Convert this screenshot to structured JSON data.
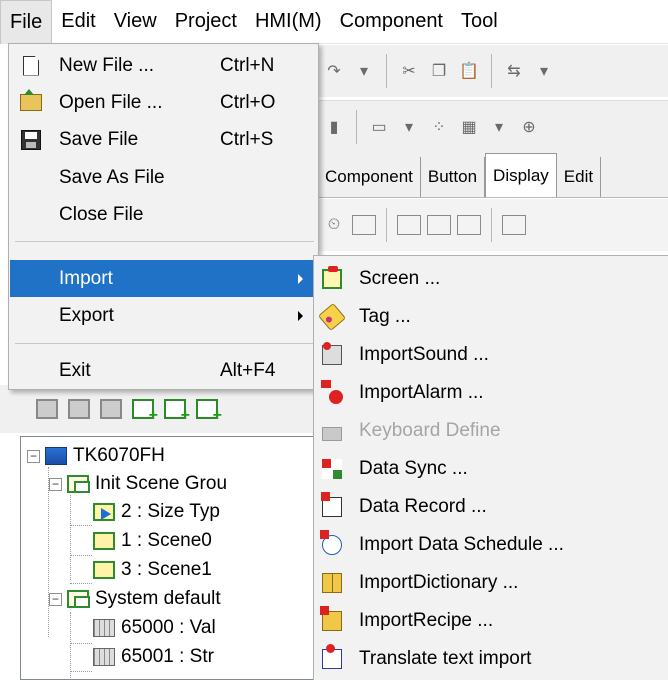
{
  "menubar": {
    "items": [
      {
        "label": "File"
      },
      {
        "label": "Edit"
      },
      {
        "label": "View"
      },
      {
        "label": "Project"
      },
      {
        "label": "HMI(M)"
      },
      {
        "label": "Component"
      },
      {
        "label": "Tool"
      }
    ]
  },
  "file_menu": {
    "items": [
      {
        "label": "New File ...",
        "shortcut": "Ctrl+N",
        "icon": "new-file-icon"
      },
      {
        "label": "Open File ...",
        "shortcut": "Ctrl+O",
        "icon": "open-folder-icon"
      },
      {
        "label": "Save File",
        "shortcut": "Ctrl+S",
        "icon": "floppy-disk-icon"
      },
      {
        "label": "Save As File",
        "shortcut": ""
      },
      {
        "label": "Close File",
        "shortcut": ""
      },
      {
        "label": "Import",
        "highlighted": true,
        "submenu": true
      },
      {
        "label": "Export",
        "submenu": true
      },
      {
        "label": "Exit",
        "shortcut": "Alt+F4"
      }
    ]
  },
  "import_submenu": {
    "items": [
      {
        "label": "Screen ...",
        "icon": "screen-import-icon"
      },
      {
        "label": "Tag ...",
        "icon": "tag-icon"
      },
      {
        "label": "ImportSound ...",
        "icon": "sound-icon"
      },
      {
        "label": "ImportAlarm ...",
        "icon": "alarm-icon"
      },
      {
        "label": "Keyboard Define",
        "icon": "keyboard-icon",
        "disabled": true
      },
      {
        "label": "Data Sync ...",
        "icon": "data-sync-icon"
      },
      {
        "label": "Data Record ...",
        "icon": "data-record-icon"
      },
      {
        "label": "Import Data Schedule ...",
        "icon": "data-schedule-icon"
      },
      {
        "label": "ImportDictionary ...",
        "icon": "dictionary-icon"
      },
      {
        "label": "ImportRecipe ...",
        "icon": "recipe-icon"
      },
      {
        "label": "Translate text import",
        "icon": "translate-icon"
      }
    ]
  },
  "component_tabs": [
    "Component",
    "Button",
    "Display",
    "Edit"
  ],
  "project_tree": {
    "root": "TK6070FH",
    "items": [
      {
        "label": "Init Scene Grou"
      },
      {
        "label": "2 : Size Typ"
      },
      {
        "label": "1 : Scene0"
      },
      {
        "label": "3 : Scene1"
      },
      {
        "label": "System default"
      },
      {
        "label": "65000 : Val"
      },
      {
        "label": "65001 : Str"
      }
    ]
  },
  "colors": {
    "highlight": "#1f72c6",
    "menu_bg": "#f2f2f2",
    "disabled_text": "#a5a5a5"
  }
}
